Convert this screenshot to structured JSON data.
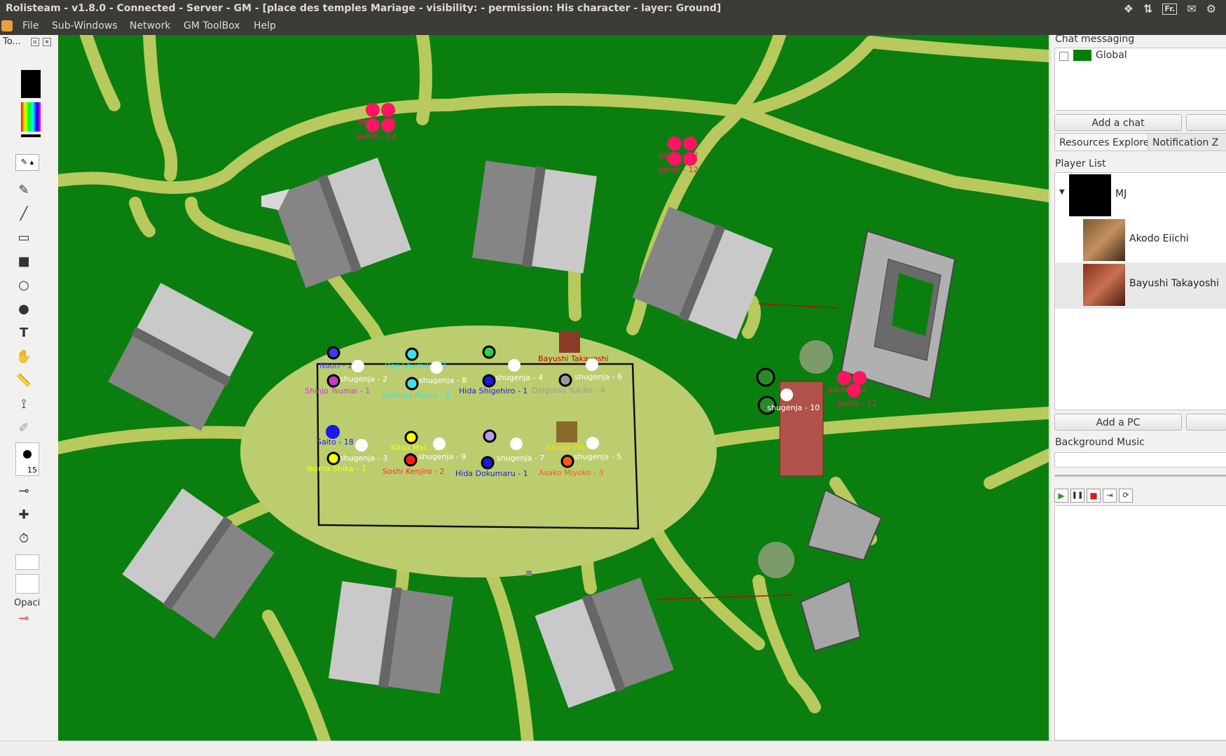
{
  "window": {
    "title": "Rolisteam - v1.8.0 - Connected - Server - GM - [place des temples Mariage - visibility:  - permission: His character - layer: Ground]",
    "keyboard_indicator": "Fr."
  },
  "menu": {
    "file": "File",
    "subwindows": "Sub-Windows",
    "network": "Network",
    "gm_toolbox": "GM ToolBox",
    "help": "Help"
  },
  "toolbox": {
    "title": "To...",
    "pen_size": "15",
    "opacity_label": "Opaci"
  },
  "right_panel": {
    "chat_title": "Chat messaging",
    "chat_global": "Global",
    "chat_global_color": "#008000",
    "add_chat": "Add a chat",
    "tab_resources": "Resources Explorer",
    "tab_notifications": "Notification Z",
    "player_list_title": "Player List",
    "players": [
      "MJ",
      "Akodo Eiichi",
      "Bayushi Takayoshi"
    ],
    "add_pc": "Add a PC",
    "music_title": "Background Music"
  },
  "map": {
    "colors": {
      "grass": "#0b7e10",
      "path": "#b8c95e",
      "plaza": "#bccd6f",
      "roof_light": "#c9c9c9",
      "roof_dark": "#858585",
      "guard": "#ff1464"
    },
    "guards": [
      {
        "label1": "garde - 12",
        "label2": "garde - 12"
      },
      {
        "label1": "garde - 12",
        "label2": "garde - 12"
      },
      {
        "label1": "garde - 12",
        "label2": "garde - 12"
      }
    ],
    "pawns": [
      {
        "name": "Naori - 2",
        "color": "#3a3af0",
        "name_color": "#4a4aff"
      },
      {
        "name": "Shinjo Tsumai - 1",
        "color": "#c53ac5",
        "name_color": "#c63cd0"
      },
      {
        "name": "Doji Shumiko - 6",
        "color": "#40e0e8",
        "name_color": "#3ae0e8"
      },
      {
        "name": "Asahina Fusae - 6",
        "color": "#40e0e8",
        "name_color": "#3ae0e8"
      },
      {
        "name": "Hida Shigehiro - 1",
        "color": "#1a1adc",
        "name_color": "#2020e0"
      },
      {
        "name": "Daigotsu Yukiko - 4",
        "color": "#999999",
        "name_color": "#9a9a9a"
      },
      {
        "name": "Saito - 18",
        "color": "#1a1ae6",
        "name_color": "#2020e8"
      },
      {
        "name": "Ikoma Shika - 1",
        "color": "#ffff00",
        "name_color": "#ffff00"
      },
      {
        "name": "Kitsu Mai - 1",
        "color": "#ffff00",
        "name_color": "#ffff00"
      },
      {
        "name": "Soshi Kenjiro - 2",
        "color": "#ff1a1a",
        "name_color": "#ff2a2a"
      },
      {
        "name": "Hida Dokumaru - 1",
        "color": "#1a1adc",
        "name_color": "#2020e0"
      },
      {
        "name": "Asako Miyoko - 3",
        "color": "#ff5a1a",
        "name_color": "#ff5a20"
      },
      {
        "name": "Bayushi Takayoshi",
        "color": "#cc0000",
        "name_color": "#d00000"
      },
      {
        "name": "Akodo Eiichi",
        "color": "#ffd700",
        "name_color": "#ffe000"
      }
    ],
    "shugenja": [
      "shugenja - 2",
      "shugenja - 8",
      "shugenja - 4",
      "shugenja - 6",
      "shugenja - 3",
      "shugenja - 9",
      "shugenja - 7",
      "shugenja - 5",
      "shugenja - 10"
    ]
  }
}
